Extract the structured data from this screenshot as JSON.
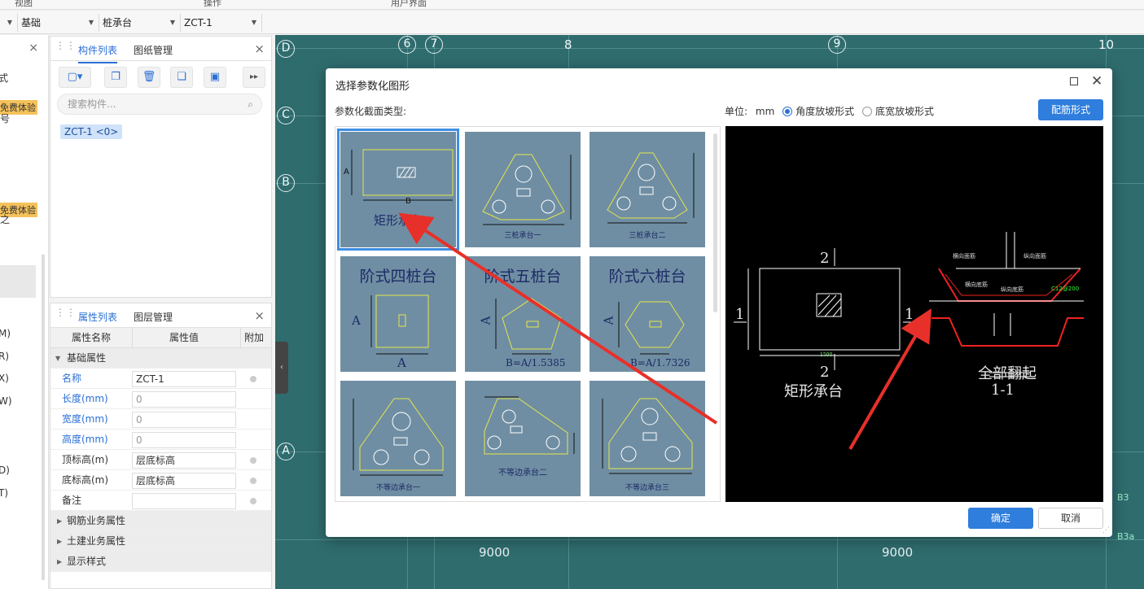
{
  "ribbon": {
    "items": [
      "视图",
      "操作",
      "用户界面"
    ]
  },
  "selectors": {
    "floor_value": "",
    "category": "基础",
    "type": "桩承台",
    "component": "ZCT-1"
  },
  "left_panel": {
    "close": "×",
    "text_top": "式",
    "trial_label_1": "免费体验",
    "trial_label_2": "免费体验",
    "frag_1": "号",
    "frag_2": "之",
    "side_letters": [
      "M)",
      "R)",
      "X)",
      "W)",
      "D)",
      "T)"
    ]
  },
  "component_panel": {
    "tabs": [
      "构件列表",
      "图纸管理"
    ],
    "close": "×",
    "search_placeholder": "搜索构件...",
    "chip": "ZCT-1 <0>",
    "more": "▸▸"
  },
  "property_panel": {
    "tabs": [
      "属性列表",
      "图层管理"
    ],
    "close": "×",
    "headers": [
      "属性名称",
      "属性值",
      "附加"
    ],
    "basic_group": "基础属性",
    "rows": [
      {
        "name": "名称",
        "value": "ZCT-1",
        "blue": true,
        "dot": true,
        "dim": false
      },
      {
        "name": "长度(mm)",
        "value": "0",
        "blue": true,
        "dot": false,
        "dim": true
      },
      {
        "name": "宽度(mm)",
        "value": "0",
        "blue": true,
        "dot": false,
        "dim": true
      },
      {
        "name": "高度(mm)",
        "value": "0",
        "blue": true,
        "dot": false,
        "dim": true
      },
      {
        "name": "顶标高(m)",
        "value": "层底标高",
        "blue": false,
        "dot": true,
        "dim": false
      },
      {
        "name": "底标高(m)",
        "value": "层底标高",
        "blue": false,
        "dot": true,
        "dim": false
      },
      {
        "name": "备注",
        "value": "",
        "blue": false,
        "dot": true,
        "dim": false
      }
    ],
    "groups": [
      "钢筋业务属性",
      "土建业务属性",
      "显示样式"
    ]
  },
  "cad": {
    "axis_letters": [
      "D",
      "C",
      "B",
      "A"
    ],
    "axis_numbers": [
      "6",
      "7",
      "8",
      "9",
      "10"
    ],
    "dim_labels": [
      "9000",
      "9000"
    ],
    "small_labels": [
      "B3",
      "B3a"
    ]
  },
  "dialog": {
    "title": "选择参数化图形",
    "section_label": "参数化截面类型:",
    "unit_label": "单位:",
    "unit_value": "mm",
    "radio_angle": "角度放坡形式",
    "radio_width": "底宽放坡形式",
    "rebar_button": "配筋形式",
    "ok": "确定",
    "cancel": "取消",
    "thumbs": [
      {
        "caption": "矩形承台",
        "selected": true
      },
      {
        "caption": "三桩承台一",
        "selected": false
      },
      {
        "caption": "三桩承台二",
        "selected": false
      },
      {
        "caption": "阶式四桩台",
        "selected": false
      },
      {
        "caption": "阶式五桩台",
        "selected": false
      },
      {
        "caption": "阶式六桩台",
        "selected": false
      },
      {
        "caption": "不等边承台一",
        "selected": false
      },
      {
        "caption": "不等边承台二",
        "selected": false
      },
      {
        "caption": "不等边承台三",
        "selected": false
      }
    ],
    "thumb_formulas": [
      "B=A/1.5385",
      "B=A/1.7326"
    ],
    "thumb_labels": {
      "a": "A",
      "b": "B"
    },
    "preview": {
      "caption_left": "矩形承台",
      "caption_right": "全部翻起",
      "section": "1-1",
      "marks": [
        "2",
        "2",
        "1",
        "1"
      ],
      "dim_1500": "1500",
      "rebar_labels": [
        "横向面筋",
        "纵向面筋",
        "横向底筋",
        "纵向底筋",
        "C12@200"
      ]
    }
  },
  "colors": {
    "accent": "#2f7ddc",
    "cad_bg": "#2f6c6e",
    "thumb_bg": "#6f8ea3",
    "arrow": "#e8302a"
  }
}
